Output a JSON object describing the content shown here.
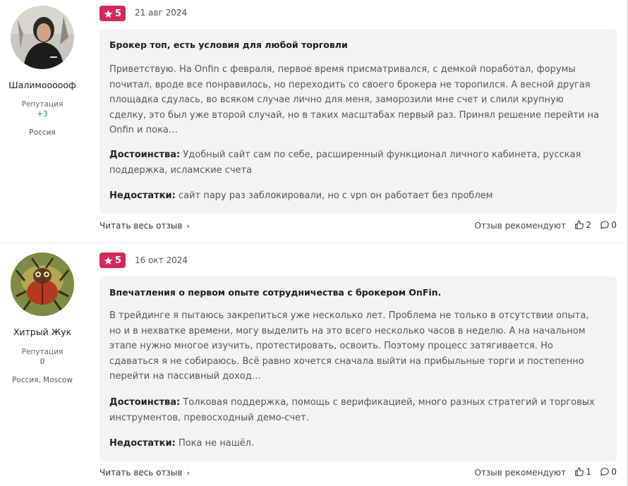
{
  "reviews": [
    {
      "author": {
        "name": "Шалимоооооф",
        "rep_label": "Репутация",
        "rep_value": "+3",
        "location": "Россия"
      },
      "rating": "5",
      "date": "21 авг 2024",
      "title": "Брокер топ, есть условия для любой торговли",
      "body": "Приветствую. На Onfin с февраля, первое время присматривался, с демкой поработал, форумы почитал, вроде все понравилось, но переходить со своего брокера не торопился. А весной другая площадка сдулась, во всяком случае лично для меня, заморозили мне счет и слили крупную сделку, это был уже второй случай, но в таких масштабах первый раз. Принял решение перейти на Onfin и пока…",
      "pros_label": "Достоинства:",
      "pros": "Удобный сайт сам по себе, расширенный функционал личного кабинета, русская поддержка, исламские счета",
      "cons_label": "Недостатки:",
      "cons": "сайт пару раз заблокировали, но с vpn он работает без проблем",
      "read_more": "Читать весь отзыв",
      "recommend": "Отзыв рекомендуют",
      "likes": "2",
      "comments": "0"
    },
    {
      "author": {
        "name": "Хитрый Жук",
        "rep_label": "Репутация",
        "rep_value": "0",
        "location": "Россия, Moscow"
      },
      "rating": "5",
      "date": "16 окт 2024",
      "title": "Впечатления о первом опыте сотрудничества с брокером OnFin.",
      "body": "В трейдинге я пытаюсь закрепиться уже несколько лет. Проблема не только в отсутствии опыта, но и в нехватке времени, могу выделить на это всего несколько часов в неделю. А на начальном этапе нужно многое изучить, протестировать, освоить. Поэтому процесс затягивается. Но сдаваться я не собираюсь. Всё равно хочется сначала выйти на прибыльные торги и постепенно перейти на пассивный доход…",
      "pros_label": "Достоинства:",
      "pros": "Толковая поддержка, помощь с верификацией, много разных стратегий и торговых инструментов, превосходный демо-счет.",
      "cons_label": "Недостатки:",
      "cons": "Пока не нашёл.",
      "read_more": "Читать весь отзыв",
      "recommend": "Отзыв рекомендуют",
      "likes": "1",
      "comments": "0"
    }
  ],
  "colors": {
    "badge": "#d8285a",
    "card_bg": "#f3f3f5",
    "rep_positive": "#1f9d3a"
  },
  "icons": [
    "star-icon",
    "chevron-right-icon",
    "thumbs-up-icon",
    "comment-icon"
  ]
}
